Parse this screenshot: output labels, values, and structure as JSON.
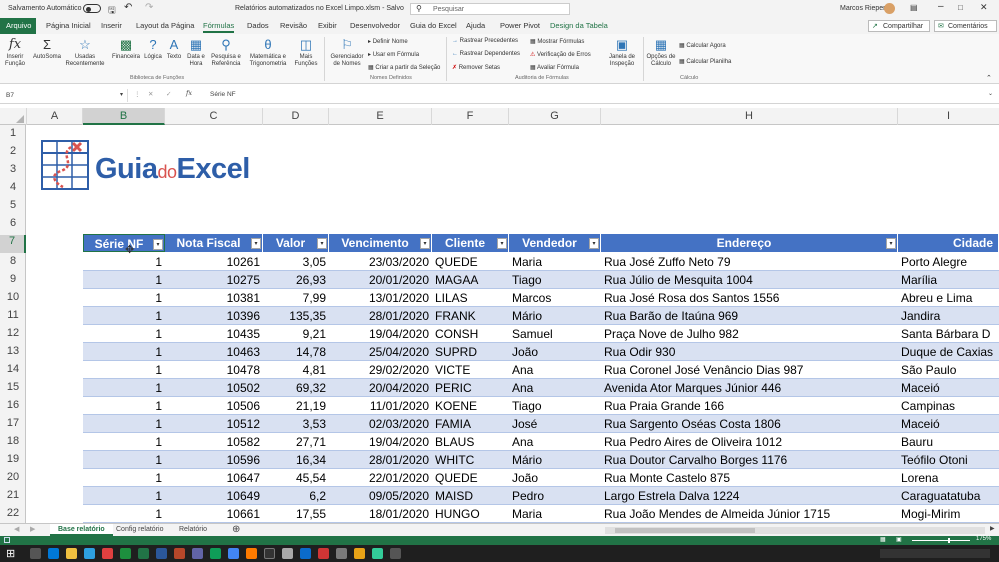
{
  "titlebar": {
    "autosave": "Salvamento Automático",
    "filename": "Relatórios automatizados no Excel Limpo.xlsm - Salvo",
    "search": "Pesquisar",
    "user": "Marcos Rieper"
  },
  "tabs": [
    "Arquivo",
    "Página Inicial",
    "Inserir",
    "Layout da Página",
    "Fórmulas",
    "Dados",
    "Revisão",
    "Exibir",
    "Desenvolvedor",
    "Guia do Excel",
    "Ajuda",
    "Power Pivot",
    "Design da Tabela"
  ],
  "share": "Compartilhar",
  "comments": "Comentários",
  "ribbon": {
    "insert_function": "Inserir Função",
    "autosum": "AutoSoma",
    "recent": "Usadas Recentemente",
    "financial": "Financeira",
    "logical": "Lógica",
    "text": "Texto",
    "datetime": "Data e Hora",
    "lookup": "Pesquisa e Referência",
    "math": "Matemática e Trigonometria",
    "more": "Mais Funções",
    "group_library": "Biblioteca de Funções",
    "name_manager": "Gerenciador de Nomes",
    "define_name": "Definir Nome",
    "use_in_formula": "Usar em Fórmula",
    "create_from_selection": "Criar a partir da Seleção",
    "group_names": "Nomes Definidos",
    "trace_precedents": "Rastrear Precedentes",
    "trace_dependents": "Rastrear Dependentes",
    "remove_arrows": "Remover Setas",
    "show_formulas": "Mostrar Fórmulas",
    "error_check": "Verificação de Erros",
    "evaluate": "Avaliar Fórmula",
    "watch": "Janela de Inspeção",
    "group_audit": "Auditoria de Fórmulas",
    "calc_options": "Opções de Cálculo",
    "calc_now": "Calcular Agora",
    "calc_sheet": "Calcular Planilha",
    "group_calc": "Cálculo"
  },
  "formula_bar": {
    "namebox": "B7",
    "content": "Série NF"
  },
  "columns": [
    "A",
    "B",
    "C",
    "D",
    "E",
    "F",
    "G",
    "H",
    "I"
  ],
  "rows": [
    "1",
    "2",
    "3",
    "4",
    "5",
    "6",
    "7",
    "8",
    "9",
    "10",
    "11",
    "12",
    "13",
    "14",
    "15",
    "16",
    "17",
    "18",
    "19",
    "20",
    "21",
    "22"
  ],
  "logo": {
    "guia": "Guia",
    "do": "do",
    "excel": "Excel"
  },
  "table": {
    "headers": [
      "Série NF",
      "Nota Fiscal",
      "Valor",
      "Vencimento",
      "Cliente",
      "Vendedor",
      "Endereço",
      "Cidade"
    ],
    "rows": [
      [
        "1",
        "10261",
        "3,05",
        "23/03/2020",
        "QUEDE",
        "Maria",
        "Rua José Zuffo Neto 79",
        "Porto Alegre"
      ],
      [
        "1",
        "10275",
        "26,93",
        "20/01/2020",
        "MAGAA",
        "Tiago",
        "Rua Júlio de Mesquita 1004",
        "Marília"
      ],
      [
        "1",
        "10381",
        "7,99",
        "13/01/2020",
        "LILAS",
        "Marcos",
        "Rua José Rosa dos Santos 1556",
        "Abreu e Lima"
      ],
      [
        "1",
        "10396",
        "135,35",
        "28/01/2020",
        "FRANK",
        "Mário",
        "Rua Barão de Itaúna 969",
        "Jandira"
      ],
      [
        "1",
        "10435",
        "9,21",
        "19/04/2020",
        "CONSH",
        "Samuel",
        "Praça Nove de Julho 982",
        "Santa Bárbara D"
      ],
      [
        "1",
        "10463",
        "14,78",
        "25/04/2020",
        "SUPRD",
        "João",
        "Rua Odir 930",
        "Duque de Caxias"
      ],
      [
        "1",
        "10478",
        "4,81",
        "29/02/2020",
        "VICTE",
        "Ana",
        "Rua Coronel José Venâncio Dias 987",
        "São Paulo"
      ],
      [
        "1",
        "10502",
        "69,32",
        "20/04/2020",
        "PERIC",
        "Ana",
        "Avenida Ator Marques Júnior 446",
        "Maceió"
      ],
      [
        "1",
        "10506",
        "21,19",
        "11/01/2020",
        "KOENE",
        "Tiago",
        "Rua Praia Grande 166",
        "Campinas"
      ],
      [
        "1",
        "10512",
        "3,53",
        "02/03/2020",
        "FAMIA",
        "José",
        "Rua Sargento Oséas Costa 1806",
        "Maceió"
      ],
      [
        "1",
        "10582",
        "27,71",
        "19/04/2020",
        "BLAUS",
        "Ana",
        "Rua Pedro Aires de Oliveira 1012",
        "Bauru"
      ],
      [
        "1",
        "10596",
        "16,34",
        "28/01/2020",
        "WHITC",
        "Mário",
        "Rua Doutor Carvalho Borges 1176",
        "Teófilo Otoni"
      ],
      [
        "1",
        "10647",
        "45,54",
        "22/01/2020",
        "QUEDE",
        "João",
        "Rua Monte Castelo 875",
        "Lorena"
      ],
      [
        "1",
        "10649",
        "6,2",
        "09/05/2020",
        "MAISD",
        "Pedro",
        "Largo Estrela Dalva 1224",
        "Caraguatatuba"
      ],
      [
        "1",
        "10661",
        "17,55",
        "18/01/2020",
        "HUNGO",
        "Maria",
        "Rua João Mendes de Almeida Júnior 1715",
        "Mogi-Mirim"
      ]
    ]
  },
  "sheets": [
    "Base relatório",
    "Config relatório",
    "Relatório"
  ],
  "zoom": "175%",
  "colors": {
    "excel_green": "#217346",
    "table_header": "#4472c4",
    "band": "#d9e1f2"
  }
}
